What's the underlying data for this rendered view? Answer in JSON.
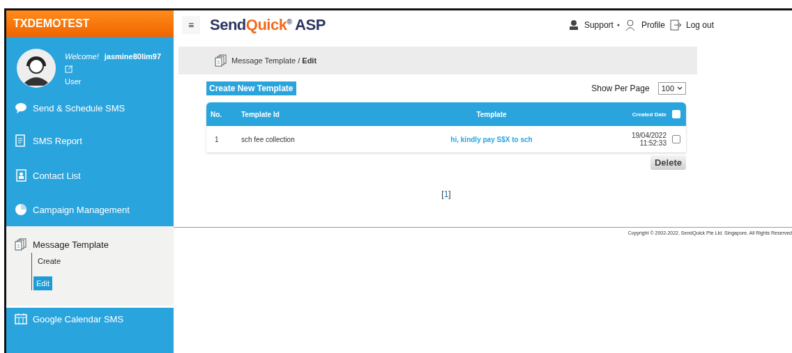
{
  "sidebar": {
    "account": "TXDEMOTEST",
    "welcome": "Welcome!",
    "username": "jasmine80lim97",
    "role": "User",
    "items": [
      {
        "kind": "sms",
        "label": "Send & Schedule SMS",
        "selected": false
      },
      {
        "kind": "report",
        "label": "SMS Report",
        "selected": false
      },
      {
        "kind": "contact",
        "label": "Contact List",
        "selected": false
      },
      {
        "kind": "campaign",
        "label": "Campaign Management",
        "selected": false
      },
      {
        "kind": "template",
        "label": "Message Template",
        "selected": true,
        "children": [
          {
            "label": "Create",
            "selected": false
          },
          {
            "label": "Edit",
            "selected": true
          }
        ]
      },
      {
        "kind": "calendar",
        "label": "Google Calendar SMS",
        "selected": false
      }
    ]
  },
  "header": {
    "menu": "≡",
    "logo": {
      "first": "Send",
      "accent": "Quick",
      "mark": "®",
      "suffix": "ASP"
    },
    "links": [
      {
        "kind": "support",
        "label": "Support",
        "dropdown": true
      },
      {
        "kind": "profile",
        "label": "Profile",
        "dropdown": false
      },
      {
        "kind": "logout",
        "label": "Log out",
        "dropdown": false
      }
    ]
  },
  "breadcrumb": {
    "parent": "Message Template /",
    "current": "Edit"
  },
  "create_button": "Create New Template",
  "per_page": {
    "label": "Show Per Page",
    "value": "100"
  },
  "table": {
    "columns": [
      "No.",
      "Template Id",
      "Template",
      "Created Date"
    ],
    "select_all": false,
    "rows": [
      {
        "no": "1",
        "template_id": "sch fee collection",
        "template": "hi, kindly pay S$X to sch",
        "date": "19/04/2022",
        "time": "11:52:33",
        "checked": false
      }
    ]
  },
  "delete_button": "Delete",
  "pagination": {
    "open": "[",
    "pages": [
      {
        "label": "1",
        "selected": true
      }
    ],
    "close": "]"
  },
  "footer": "Copyright © 2002-2022, SendQuick Pte Ltd. Singapore. All Rights Reserved"
}
